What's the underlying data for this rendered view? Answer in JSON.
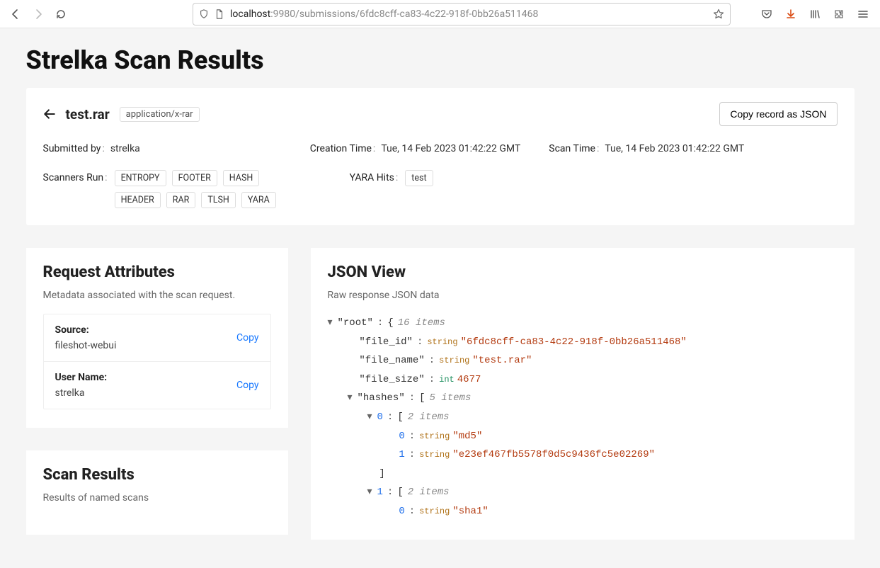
{
  "browser": {
    "url_host": "localhost",
    "url_rest": ":9980/submissions/6fdc8cff-ca83-4c22-918f-0bb26a511468"
  },
  "page": {
    "title": "Strelka Scan Results"
  },
  "summary": {
    "file_name": "test.rar",
    "mime": "application/x-rar",
    "copy_label": "Copy record as JSON",
    "submitted_by_label": "Submitted by",
    "submitted_by": "strelka",
    "creation_time_label": "Creation Time",
    "creation_time": "Tue, 14 Feb 2023 01:42:22 GMT",
    "scan_time_label": "Scan Time",
    "scan_time": "Tue, 14 Feb 2023 01:42:22 GMT",
    "scanners_label": "Scanners Run",
    "scanners": [
      "ENTROPY",
      "FOOTER",
      "HASH",
      "HEADER",
      "RAR",
      "TLSH",
      "YARA"
    ],
    "yara_label": "YARA Hits",
    "yara_hits": [
      "test"
    ]
  },
  "request_attrs": {
    "heading": "Request Attributes",
    "subtitle": "Metadata associated with the scan request.",
    "rows": [
      {
        "key": "Source:",
        "value": "fileshot-webui",
        "action": "Copy"
      },
      {
        "key": "User Name:",
        "value": "strelka",
        "action": "Copy"
      }
    ]
  },
  "scan_results": {
    "heading": "Scan Results",
    "subtitle": "Results of named scans"
  },
  "json_view": {
    "heading": "JSON View",
    "subtitle": "Raw response JSON data",
    "root_key": "root",
    "root_items_hint": "16 items",
    "file_id_key": "file_id",
    "file_id_val": "6fdc8cff-ca83-4c22-918f-0bb26a511468",
    "file_name_key": "file_name",
    "file_name_val": "test.rar",
    "file_size_key": "file_size",
    "file_size_val": "4677",
    "hashes_key": "hashes",
    "hashes_hint": "5 items",
    "hash0_idx": "0",
    "hash0_hint": "2 items",
    "hash0_0_idx": "0",
    "hash0_0_val": "md5",
    "hash0_1_idx": "1",
    "hash0_1_val": "e23ef467fb5578f0d5c9436fc5e02269",
    "hash1_idx": "1",
    "hash1_hint": "2 items",
    "hash1_0_idx": "0",
    "hash1_0_val": "sha1",
    "type_str": "string",
    "type_int": "int"
  }
}
